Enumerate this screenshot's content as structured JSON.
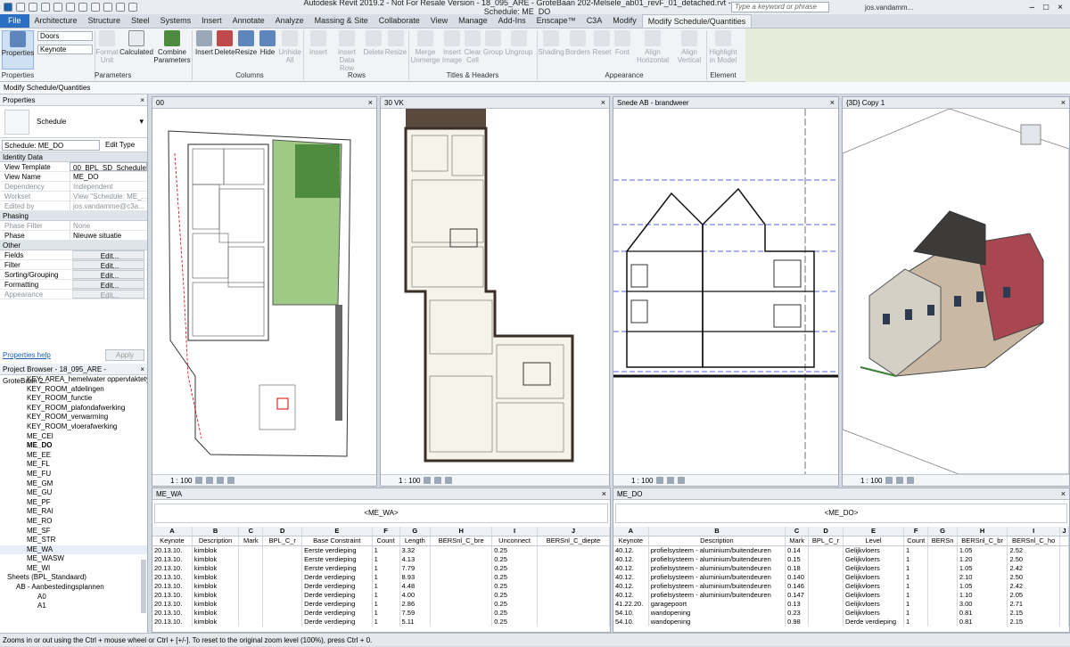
{
  "titlebar": {
    "title": "Autodesk Revit 2019.2 - Not For Resale Version - 18_095_ARE - GroteBaan 202-Melsele_ab01_revF_01_detached.rvt - Schedule: ME_DO",
    "search_placeholder": "Type a keyword or phrase",
    "user": "jos.vandamm..."
  },
  "tabs": [
    "File",
    "Architecture",
    "Structure",
    "Steel",
    "Systems",
    "Insert",
    "Annotate",
    "Analyze",
    "Massing & Site",
    "Collaborate",
    "View",
    "Manage",
    "Add-Ins",
    "Enscape™",
    "C3A",
    "Modify",
    "Modify Schedule/Quantities"
  ],
  "ribbon": {
    "properties": "Properties",
    "doors": "Doors",
    "keynote": "Keynote",
    "format_unit": "Format Unit",
    "calculated": "Calculated",
    "combine": "Combine Parameters",
    "insert": "Insert",
    "delete": "Delete",
    "resize": "Resize",
    "hide": "Hide",
    "unhide_all": "Unhide All",
    "insert2": "Insert",
    "insert_data_row": "Insert Data Row",
    "delete2": "Delete",
    "resize2": "Resize",
    "merge": "Merge Unmerge",
    "insert_image": "Insert Image",
    "clear_cell": "Clear Cell",
    "group": "Group",
    "ungroup": "Ungroup",
    "shading": "Shading",
    "borders": "Borders",
    "reset": "Reset",
    "font": "Font",
    "align_h": "Align Horizontal",
    "align_v": "Align Vertical",
    "highlight": "Highlight in Model",
    "groups": {
      "properties": "Properties",
      "parameters": "Parameters",
      "columns": "Columns",
      "rows": "Rows",
      "titles": "Titles & Headers",
      "appearance": "Appearance",
      "element": "Element"
    }
  },
  "context_bar": "Modify Schedule/Quantities",
  "properties_panel": {
    "title": "Properties",
    "type": "Schedule",
    "selector": "Schedule: ME_DO",
    "edit_type": "Edit Type",
    "sections": [
      {
        "name": "Identity Data",
        "rows": [
          [
            "View Template",
            "00_BPL_SD_Schedules"
          ],
          [
            "View Name",
            "ME_DO"
          ],
          [
            "Dependency",
            "Independent"
          ],
          [
            "Workset",
            "View \"Schedule: ME_..."
          ],
          [
            "Edited by",
            "jos.vandamme@c3a..."
          ]
        ]
      },
      {
        "name": "Phasing",
        "rows": [
          [
            "Phase Filter",
            "None"
          ],
          [
            "Phase",
            "Nieuwe situatie"
          ]
        ]
      },
      {
        "name": "Other",
        "rows": [
          [
            "Fields",
            "Edit..."
          ],
          [
            "Filter",
            "Edit..."
          ],
          [
            "Sorting/Grouping",
            "Edit..."
          ],
          [
            "Formatting",
            "Edit..."
          ],
          [
            "Appearance",
            "Edit..."
          ]
        ]
      }
    ],
    "help": "Properties help",
    "apply": "Apply"
  },
  "browser": {
    "title": "Project Browser - 18_095_ARE - GroteBaan 2...",
    "items": [
      "KEY_AREA_hemelwater oppervlaktetyp",
      "KEY_ROOM_afdelingen",
      "KEY_ROOM_functie",
      "KEY_ROOM_plafondafwerking",
      "KEY_ROOM_verwarming",
      "KEY_ROOM_vloerafwerking",
      "ME_CEI",
      "ME_DO",
      "ME_EE",
      "ME_FL",
      "ME_FU",
      "ME_GM",
      "ME_GU",
      "ME_PF",
      "ME_RAI",
      "ME_RO",
      "ME_SF",
      "ME_STR",
      "ME_WA",
      "ME_WASW",
      "ME_WI",
      "Sheets (BPL_Standaard)",
      "AB - Aanbestedingsplannen",
      "A0",
      "A1"
    ]
  },
  "views": {
    "v1": {
      "title": "00",
      "scale": "1 : 100"
    },
    "v2": {
      "title": "30 VK",
      "scale": "1 : 100"
    },
    "v3": {
      "title": "Snede AB - brandweer",
      "scale": "1 : 100"
    },
    "v4": {
      "title": "{3D} Copy 1",
      "scale": "1 : 100"
    }
  },
  "sched_wa": {
    "tab": "ME_WA",
    "title": "<ME_WA>",
    "letters": [
      "A",
      "B",
      "C",
      "D",
      "E",
      "F",
      "G",
      "H",
      "I",
      "J"
    ],
    "headers": [
      "Keynote",
      "Description",
      "Mark",
      "BPL_C_r",
      "Base Constraint",
      "Count",
      "Length",
      "BERSnl_C_bre",
      "Unconnect",
      "BERSnl_C_diepte"
    ],
    "rows": [
      [
        "20.13.10.",
        "kimblok",
        "",
        "",
        "Eerste verdieping",
        "1",
        "3.32",
        "",
        "0.25",
        ""
      ],
      [
        "20.13.10.",
        "kimblok",
        "",
        "",
        "Eerste verdieping",
        "1",
        "4.13",
        "",
        "0.25",
        ""
      ],
      [
        "20.13.10.",
        "kimblok",
        "",
        "",
        "Eerste verdieping",
        "1",
        "7.79",
        "",
        "0.25",
        ""
      ],
      [
        "20.13.10.",
        "kimblok",
        "",
        "",
        "Derde verdieping",
        "1",
        "8.93",
        "",
        "0.25",
        ""
      ],
      [
        "20.13.10.",
        "kimblok",
        "",
        "",
        "Derde verdieping",
        "1",
        "4.48",
        "",
        "0.25",
        ""
      ],
      [
        "20.13.10.",
        "kimblok",
        "",
        "",
        "Derde verdieping",
        "1",
        "4.00",
        "",
        "0.25",
        ""
      ],
      [
        "20.13.10.",
        "kimblok",
        "",
        "",
        "Derde verdieping",
        "1",
        "2.86",
        "",
        "0.25",
        ""
      ],
      [
        "20.13.10.",
        "kimblok",
        "",
        "",
        "Derde verdieping",
        "1",
        "7.59",
        "",
        "0.25",
        ""
      ],
      [
        "20.13.10.",
        "kimblok",
        "",
        "",
        "Derde verdieping",
        "1",
        "5.11",
        "",
        "0.25",
        ""
      ]
    ]
  },
  "sched_do": {
    "tab": "ME_DO",
    "title": "<ME_DO>",
    "letters": [
      "A",
      "B",
      "C",
      "D",
      "E",
      "F",
      "G",
      "H",
      "I",
      "J"
    ],
    "headers": [
      "Keynote",
      "Description",
      "Mark",
      "BPL_C_r",
      "Level",
      "Count",
      "BERSn",
      "BERSnl_C_br",
      "BERSnl_C_ho",
      ""
    ],
    "rows": [
      [
        "40.12.",
        "profielsysteem - aluminium/buitendeuren",
        "0.14",
        "",
        "Gelijkvloers",
        "1",
        "",
        "1.05",
        "2.52",
        ""
      ],
      [
        "40.12.",
        "profielsysteem - aluminium/buitendeuren",
        "0.15",
        "",
        "Gelijkvloers",
        "1",
        "",
        "1.20",
        "2.50",
        ""
      ],
      [
        "40.12.",
        "profielsysteem - aluminium/buitendeuren",
        "0.18",
        "",
        "Gelijkvloers",
        "1",
        "",
        "1.05",
        "2.42",
        ""
      ],
      [
        "40.12.",
        "profielsysteem - aluminium/buitendeuren",
        "0.140",
        "",
        "Gelijkvloers",
        "1",
        "",
        "2.10",
        "2.50",
        ""
      ],
      [
        "40.12.",
        "profielsysteem - aluminium/buitendeuren",
        "0.146",
        "",
        "Gelijkvloers",
        "1",
        "",
        "1.05",
        "2.42",
        ""
      ],
      [
        "40.12.",
        "profielsysteem - aluminium/buitendeuren",
        "0.147",
        "",
        "Gelijkvloers",
        "1",
        "",
        "1.10",
        "2.05",
        ""
      ],
      [
        "41.22.20.",
        "garagepoort",
        "0.13",
        "",
        "Gelijkvloers",
        "1",
        "",
        "3.00",
        "2.71",
        ""
      ],
      [
        "54.10.",
        "wandopening",
        "0.23",
        "",
        "Gelijkvloers",
        "1",
        "",
        "0.81",
        "2.15",
        ""
      ],
      [
        "54.10.",
        "wandopening",
        "0.98",
        "",
        "Derde verdieping",
        "1",
        "",
        "0.81",
        "2.15",
        ""
      ]
    ]
  },
  "status": "Zooms in or out using the Ctrl + mouse wheel or Ctrl + [+/-]. To reset to the original zoom level (100%), press Ctrl + 0."
}
